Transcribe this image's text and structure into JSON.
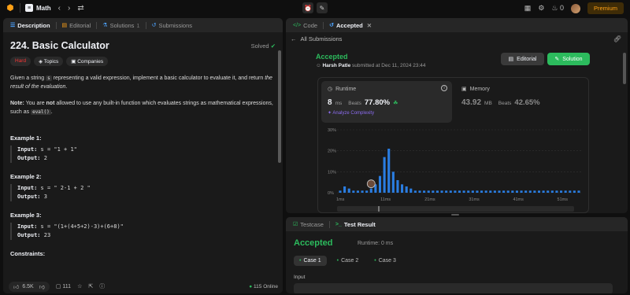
{
  "topbar": {
    "problem_list": "Math",
    "premium": "Premium",
    "streak": "0"
  },
  "left": {
    "tabs": [
      {
        "label": "Description"
      },
      {
        "label": "Editorial"
      },
      {
        "label": "Solutions"
      },
      {
        "label": "Submissions"
      }
    ],
    "solutions_count": "1",
    "title": "224. Basic Calculator",
    "solved": "Solved",
    "badges": {
      "difficulty": "Hard",
      "topics": "Topics",
      "companies": "Companies"
    },
    "para1_a": "Given a string ",
    "para1_code": "s",
    "para1_b": " representing a valid expression, implement a basic calculator to evaluate it, and return ",
    "para1_em": "the result of the evaluation",
    "para1_c": ".",
    "note_label": "Note:",
    "note_a": " You are ",
    "note_not": "not",
    "note_b": " allowed to use any built-in function which evaluates strings as mathematical expressions, such as ",
    "note_code": "eval()",
    "note_c": ".",
    "examples": [
      {
        "title": "Example 1:",
        "input": "s = \"1 + 1\"",
        "output": "2"
      },
      {
        "title": "Example 2:",
        "input": "s = \" 2-1 + 2 \"",
        "output": "3"
      },
      {
        "title": "Example 3:",
        "input": "s = \"(1+(4+5+2)-3)+(6+8)\"",
        "output": "23"
      }
    ],
    "input_label": "Input:",
    "output_label": "Output:",
    "constraints": "Constraints:",
    "footer": {
      "likes": "6.5K",
      "comments": "111",
      "online": "115 Online"
    }
  },
  "submission": {
    "tabs": [
      {
        "label": "Code"
      },
      {
        "label": "Accepted"
      }
    ],
    "all_submissions": "All Submissions",
    "status": "Accepted",
    "user": "Harsh Patle",
    "submitted_text": "submitted at Dec 11, 2024 23:44",
    "editorial_btn": "Editorial",
    "solution_btn": "Solution",
    "runtime": {
      "label": "Runtime",
      "value": "8",
      "unit": "ms",
      "beats_label": "Beats",
      "beats": "77.80%",
      "analyze": "Analyze Complexity"
    },
    "memory": {
      "label": "Memory",
      "value": "43.92",
      "unit": "MB",
      "beats_label": "Beats",
      "beats": "42.65%"
    }
  },
  "test_result": {
    "tabs": [
      {
        "label": "Testcase"
      },
      {
        "label": "Test Result"
      }
    ],
    "status": "Accepted",
    "runtime": "Runtime: 0 ms",
    "cases": [
      "Case 1",
      "Case 2",
      "Case 3"
    ],
    "input_label": "Input"
  },
  "chart_data": {
    "type": "bar",
    "title": "",
    "xlabel": "",
    "ylabel": "",
    "ylim": [
      0,
      30
    ],
    "y_ticks": [
      "0%",
      "10%",
      "20%",
      "30%"
    ],
    "x_ticks": [
      "1ms",
      "11ms",
      "21ms",
      "31ms",
      "41ms",
      "51ms"
    ],
    "x_tick_values": [
      1,
      11,
      21,
      31,
      41,
      51
    ],
    "x": [
      1,
      2,
      3,
      4,
      5,
      6,
      7,
      8,
      9,
      10,
      11,
      12,
      13,
      14,
      15,
      16,
      17,
      18,
      19,
      20,
      21,
      22,
      23,
      24,
      25,
      26,
      27,
      28,
      29,
      30,
      31,
      32,
      33,
      34,
      35,
      36,
      37,
      38,
      39,
      40,
      41,
      42,
      43,
      44,
      45,
      46,
      47,
      48,
      49,
      50,
      51,
      52,
      53,
      54,
      55
    ],
    "values": [
      1,
      3,
      2,
      1,
      1,
      1,
      1,
      2,
      4,
      8,
      17,
      21,
      10,
      6,
      4,
      3,
      2,
      1,
      1,
      1,
      1,
      1,
      1,
      1,
      1,
      1,
      1,
      1,
      1,
      1,
      1,
      1,
      1,
      1,
      1,
      1,
      1,
      1,
      1,
      1,
      1,
      1,
      1,
      1,
      1,
      1,
      1,
      1,
      1,
      1,
      1,
      1,
      1,
      1,
      1
    ],
    "highlight_x": 8,
    "bar_color": "#2a7de1",
    "grid": true
  },
  "colors": {
    "accent_green": "#2cbb5d",
    "hard": "#f63636",
    "premium": "#ffa116",
    "purple": "#8c6cf0"
  }
}
